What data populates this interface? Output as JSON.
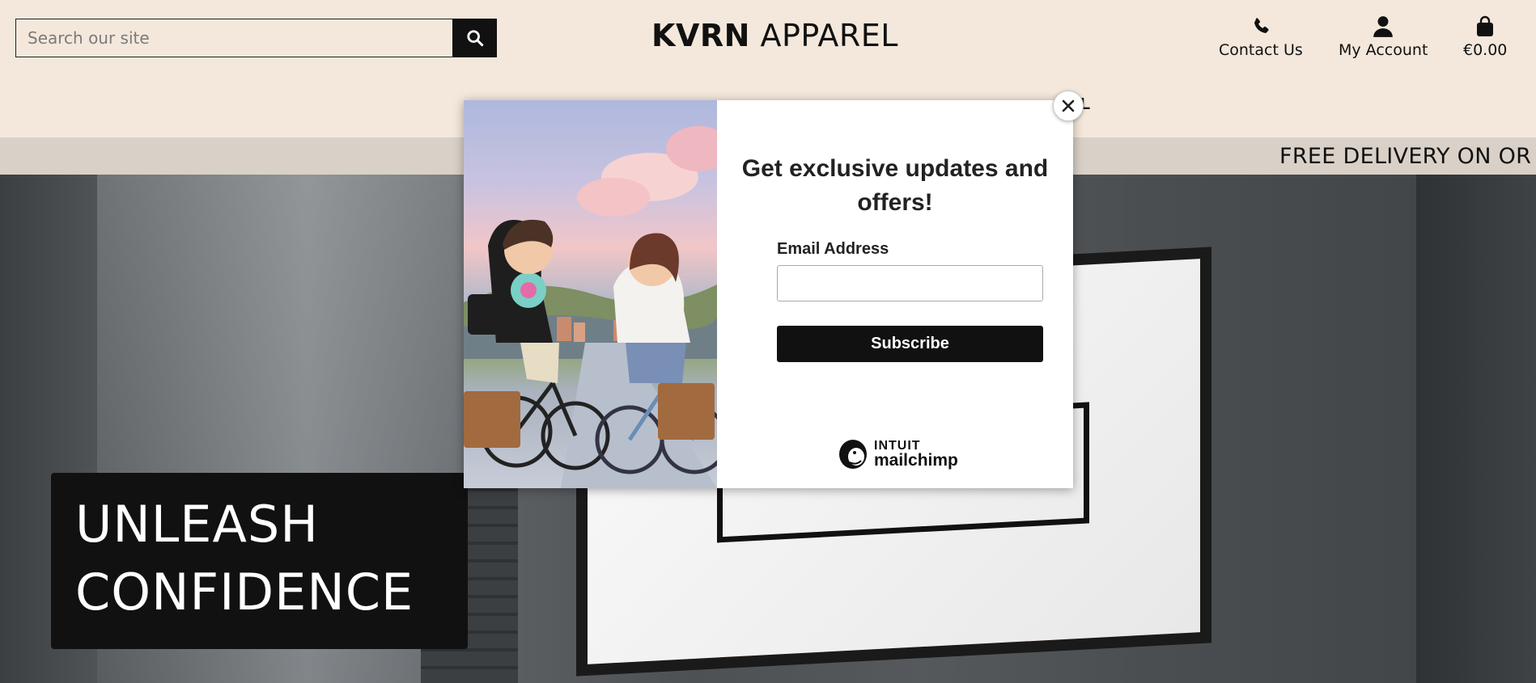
{
  "header": {
    "search": {
      "placeholder": "Search our site",
      "value": ""
    },
    "logo": {
      "bold": "KVRN",
      "light": " APPAREL"
    },
    "utilities": [
      {
        "label": "Contact Us",
        "icon": "phone-icon"
      },
      {
        "label": "My Account",
        "icon": "user-icon"
      },
      {
        "label": "€0.00",
        "icon": "shopping-bag-icon"
      }
    ],
    "nav_fragment": "L"
  },
  "banner": {
    "text": "FREE DELIVERY ON OR"
  },
  "hero": {
    "line1": "UNLEASH",
    "line2": "CONFIDENCE"
  },
  "modal": {
    "title": "Get exclusive updates and offers!",
    "email_label": "Email Address",
    "email_value": "",
    "submit_label": "Subscribe",
    "brand_top": "INTUIT",
    "brand_bottom": "mailchimp",
    "close_label": "✕"
  },
  "colors": {
    "header_bg": "#f4e8dc",
    "banner_bg": "#d9d1c7",
    "button_bg": "#111111"
  }
}
